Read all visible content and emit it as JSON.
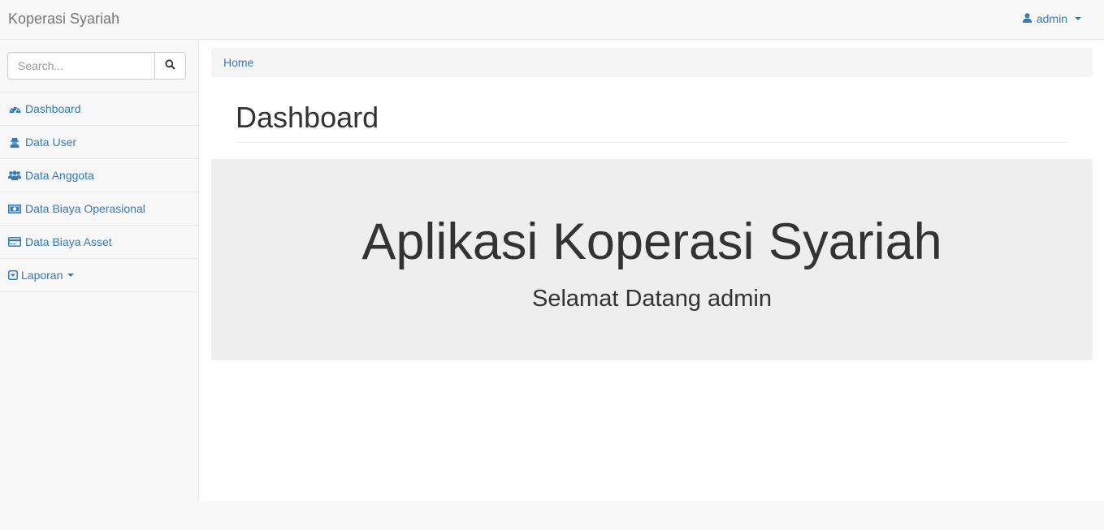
{
  "navbar": {
    "brand": "Koperasi Syariah",
    "user_label": "admin"
  },
  "sidebar": {
    "search_placeholder": "Search...",
    "items": [
      {
        "label": "Dashboard",
        "icon": "dashboard-icon"
      },
      {
        "label": "Data User",
        "icon": "user-secret-icon"
      },
      {
        "label": "Data Anggota",
        "icon": "users-icon"
      },
      {
        "label": "Data Biaya Operasional",
        "icon": "money-icon"
      },
      {
        "label": "Data Biaya Asset",
        "icon": "credit-card-icon"
      },
      {
        "label": "Laporan",
        "icon": "caret-square-down-icon"
      }
    ]
  },
  "main": {
    "breadcrumb": "Home",
    "page_title": "Dashboard",
    "jumbotron": {
      "title": "Aplikasi Koperasi Syariah",
      "subtitle": "Selamat Datang admin"
    }
  },
  "colors": {
    "link": "#337ab7",
    "navbar_bg": "#f8f8f8",
    "jumbotron_bg": "#eeeeee"
  }
}
